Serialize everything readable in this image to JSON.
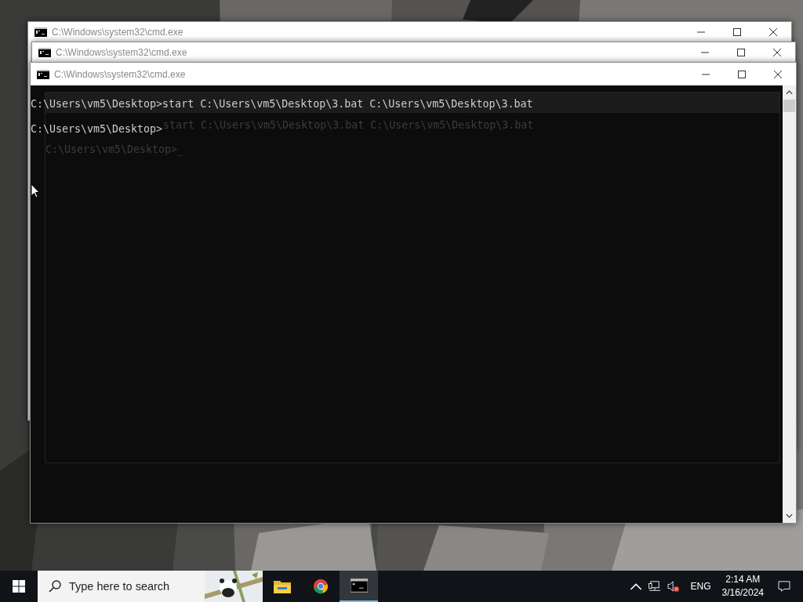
{
  "windows": [
    {
      "title": "C:\\Windows\\system32\\cmd.exe"
    },
    {
      "title": "C:\\Windows\\system32\\cmd.exe"
    },
    {
      "title": "C:\\Windows\\system32\\cmd.exe"
    }
  ],
  "console": {
    "lines": [
      "C:\\Users\\vm5\\Desktop>start C:\\Users\\vm5\\Desktop\\3.bat C:\\Users\\vm5\\Desktop\\3.bat",
      "C:\\Users\\vm5\\Desktop>"
    ]
  },
  "ghost_window": {
    "lines": [
      "start C:\\Users\\vm5\\Desktop\\3.bat C:\\Users\\vm5\\Desktop\\3.bat",
      "C:\\Users\\vm5\\Desktop>_"
    ]
  },
  "taskbar": {
    "search": {
      "placeholder": "Type here to search"
    },
    "apps": [
      {
        "kind": "explorer",
        "selected": false
      },
      {
        "kind": "chrome",
        "selected": false
      },
      {
        "kind": "terminal",
        "selected": true
      }
    ],
    "language": "ENG",
    "time": "2:14 AM",
    "date": "3/16/2024"
  }
}
